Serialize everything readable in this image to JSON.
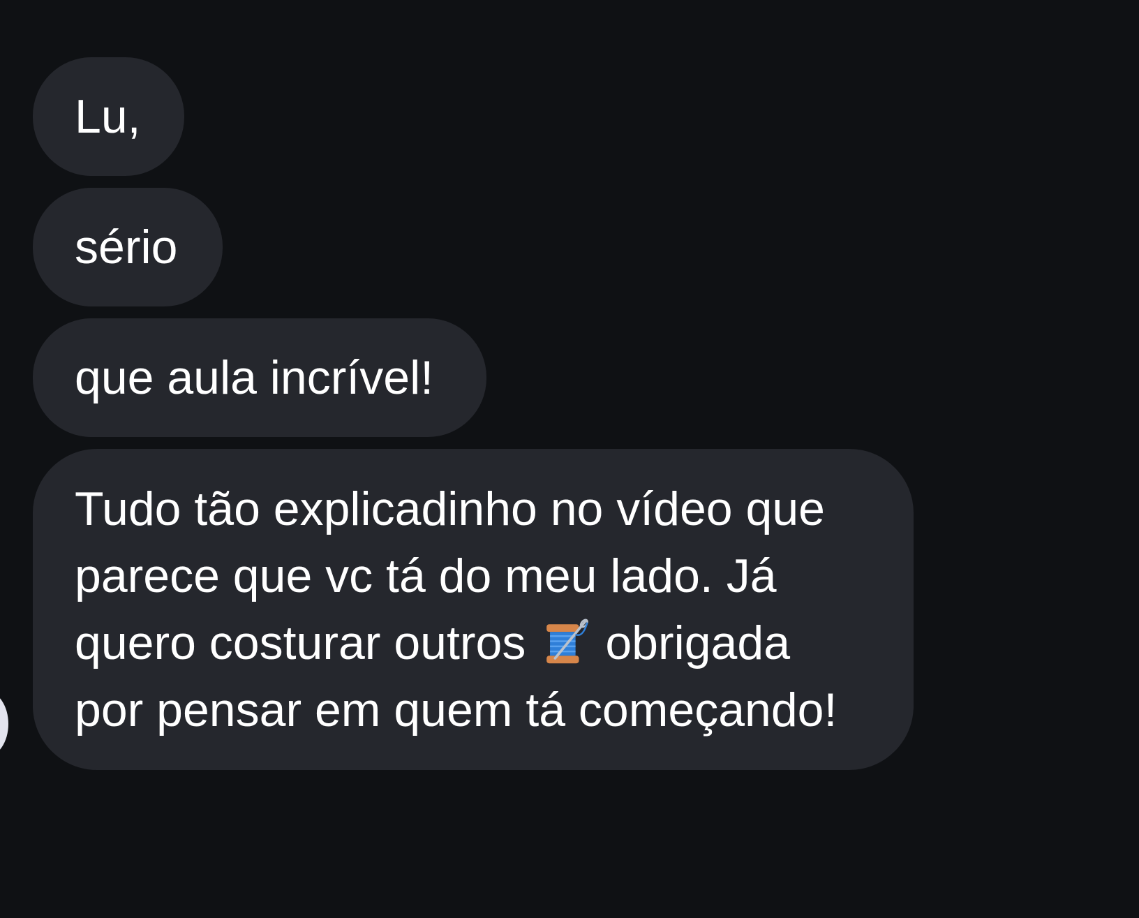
{
  "messages": [
    {
      "id": "msg-1",
      "text": "Lu,"
    },
    {
      "id": "msg-2",
      "text": "sério"
    },
    {
      "id": "msg-3",
      "text": "que aula incrível!"
    },
    {
      "id": "msg-4",
      "lines": [
        "Tudo tão explicadinho no vídeo que",
        "parece que vc tá do meu lado. Já",
        "quero costurar outros",
        "obrigada",
        "por pensar em quem tá começando!"
      ],
      "emoji": "spool-of-thread-icon"
    }
  ],
  "colors": {
    "background": "#0f1114",
    "bubble": "#25272d",
    "text": "#ffffff",
    "avatar": "#e3e4ee"
  }
}
